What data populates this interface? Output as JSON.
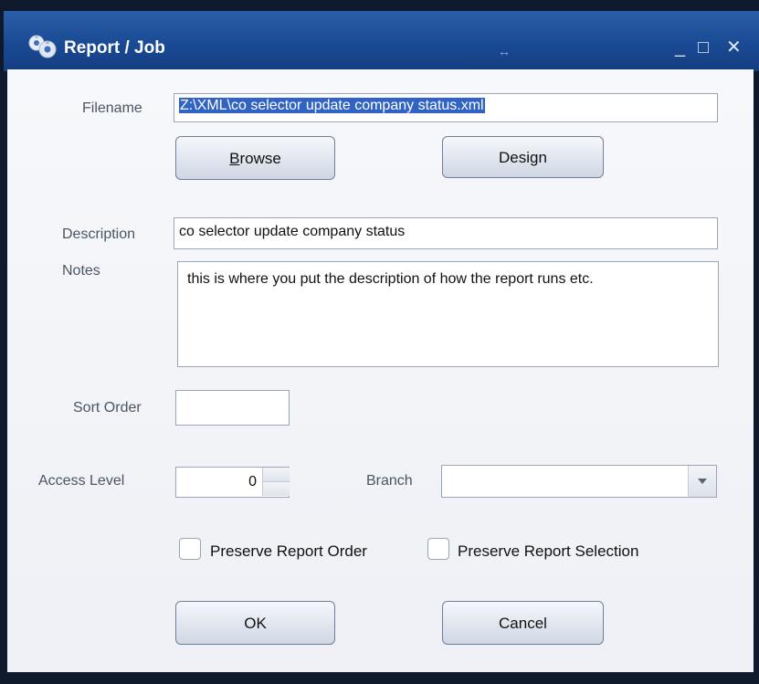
{
  "window": {
    "title": "Report / Job",
    "resize_glyph": "↔",
    "minimize": "_",
    "maximize": "□",
    "close": "✕"
  },
  "form": {
    "filename_label": "Filename",
    "filename_value": "Z:\\XML\\co selector update company status.xml",
    "browse_label": "Browse",
    "design_label": "Design",
    "description_label": "Description",
    "description_value": "co selector update company status",
    "notes_label": "Notes",
    "notes_value": "this is where you put the description of how the report runs etc.",
    "sort_order_label": "Sort Order",
    "sort_order_value": "",
    "access_level_label": "Access Level",
    "access_level_value": "0",
    "branch_label": "Branch",
    "branch_value": "",
    "preserve_order_label": "Preserve Report Order",
    "preserve_order_checked": false,
    "preserve_selection_label": "Preserve Report Selection",
    "preserve_selection_checked": false,
    "ok_label": "OK",
    "cancel_label": "Cancel"
  }
}
